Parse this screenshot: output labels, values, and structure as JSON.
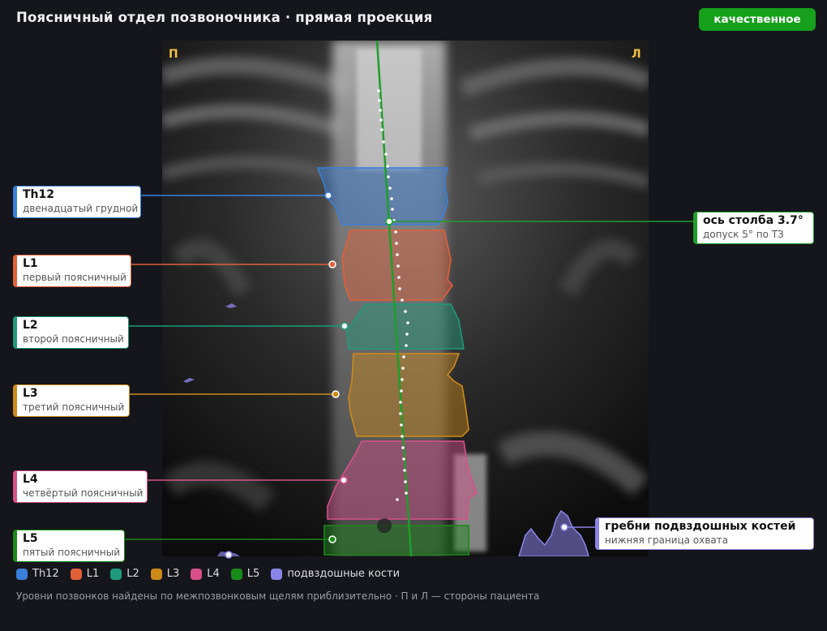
{
  "header": {
    "title": "Поясничный отдел позвоночника · прямая проекция",
    "quality_badge": "качественное",
    "quality_color": "#16a01c"
  },
  "image": {
    "side_right_marker": "П",
    "side_left_marker": "Л",
    "marker_color": "#f0c040"
  },
  "vertebrae": [
    {
      "id": "Th12",
      "title": "Th12",
      "subtitle": "двенадцатый грудной",
      "color": "#3a7fd9"
    },
    {
      "id": "L1",
      "title": "L1",
      "subtitle": "первый поясничный",
      "color": "#e0603a"
    },
    {
      "id": "L2",
      "title": "L2",
      "subtitle": "второй поясничный",
      "color": "#1f9a7a"
    },
    {
      "id": "L3",
      "title": "L3",
      "subtitle": "третий поясничный",
      "color": "#cc8a1a"
    },
    {
      "id": "L4",
      "title": "L4",
      "subtitle": "четвёртый поясничный",
      "color": "#d8508a"
    },
    {
      "id": "L5",
      "title": "L5",
      "subtitle": "пятый поясничный",
      "color": "#1a8a1a"
    }
  ],
  "axis": {
    "title": "ось столба 3.7°",
    "subtitle": "допуск 5° по ТЗ",
    "color": "#1e9e2a"
  },
  "iliac": {
    "title": "гребни подвздошных костей",
    "subtitle": "нижняя граница охвата",
    "color": "#8a84e8"
  },
  "legend": [
    {
      "label": "Th12",
      "color": "#3a7fd9"
    },
    {
      "label": "L1",
      "color": "#e0603a"
    },
    {
      "label": "L2",
      "color": "#1f9a7a"
    },
    {
      "label": "L3",
      "color": "#cc8a1a"
    },
    {
      "label": "L4",
      "color": "#d8508a"
    },
    {
      "label": "L5",
      "color": "#1a8a1a"
    },
    {
      "label": "подвздошные кости",
      "color": "#8a84e8"
    }
  ],
  "footnote": "Уровни позвонков найдены по межпозвонковым щелям приблизительно · П и Л — стороны пациента"
}
